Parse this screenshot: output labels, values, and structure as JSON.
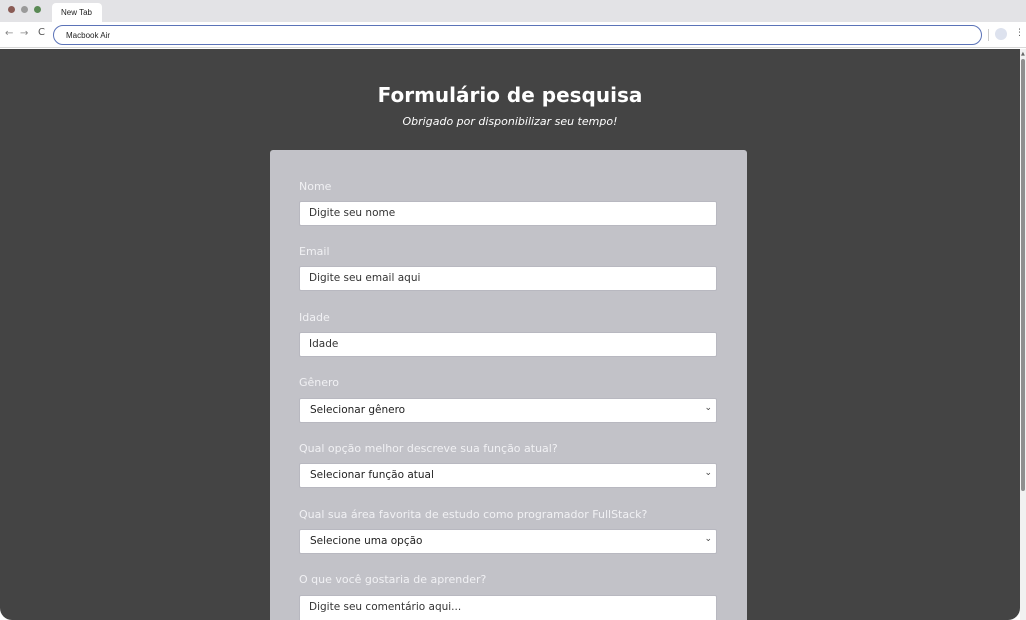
{
  "browser": {
    "tab_title": "New Tab",
    "url": "Macbook Air",
    "back": "←",
    "forward": "→",
    "reload": "C",
    "menu": "⋮"
  },
  "header": {
    "title": "Formulário de pesquisa",
    "subtitle": "Obrigado por disponibilizar seu tempo!"
  },
  "form": {
    "name": {
      "label": "Nome",
      "placeholder": "Digite seu nome"
    },
    "email": {
      "label": "Email",
      "placeholder": "Digite seu email aqui"
    },
    "age": {
      "label": "Idade",
      "placeholder": "Idade"
    },
    "gender": {
      "label": "Gênero",
      "selected": "Selecionar gênero"
    },
    "role": {
      "label": "Qual opção melhor descreve sua função atual?",
      "selected": "Selecionar função atual"
    },
    "area": {
      "label": "Qual sua área favorita de estudo como programador FullStack?",
      "selected": "Selecione uma opção"
    },
    "learn": {
      "label": "O que você gostaria de aprender?",
      "placeholder": "Digite seu comentário aqui..."
    }
  },
  "icons": {
    "dropdown": "chevron-down-icon",
    "chevron_glyph": "⌄"
  }
}
